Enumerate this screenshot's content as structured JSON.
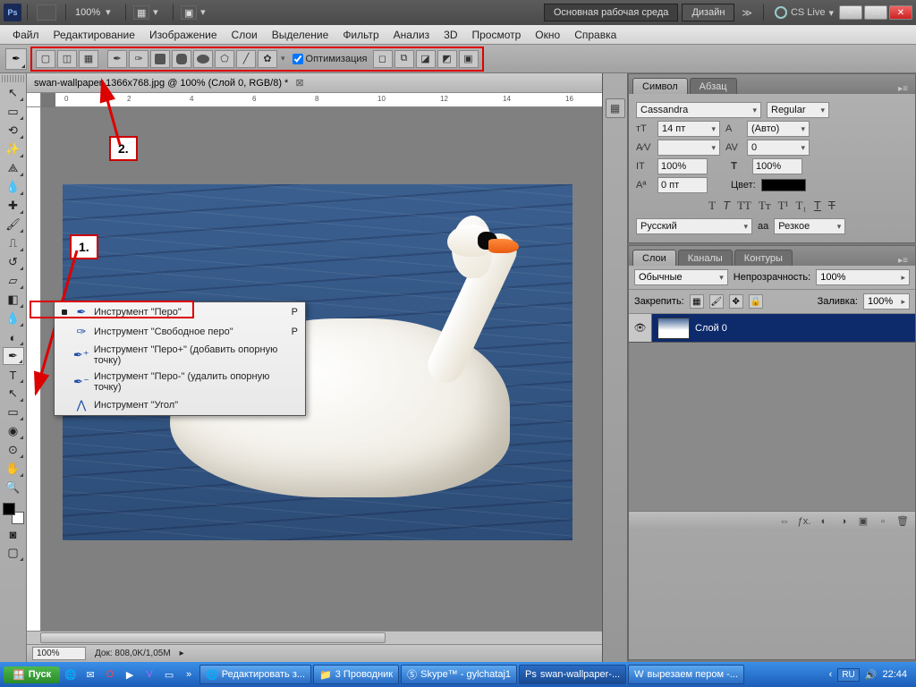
{
  "titlebar": {
    "zoom": "100%",
    "workspace_main": "Основная рабочая среда",
    "workspace_design": "Дизайн",
    "cslive": "CS Live"
  },
  "menu": {
    "file": "Файл",
    "edit": "Редактирование",
    "image": "Изображение",
    "layer": "Слои",
    "select": "Выделение",
    "filter": "Фильтр",
    "analysis": "Анализ",
    "threed": "3D",
    "view": "Просмотр",
    "window": "Окно",
    "help": "Справка"
  },
  "optbar": {
    "optimize": "Оптимизация"
  },
  "doc": {
    "tab": "swan-wallpaper-1366x768.jpg @ 100% (Слой 0, RGB/8) *",
    "status_zoom": "100%",
    "status_doc": "Док: 808,0K/1,05M"
  },
  "annotations": {
    "one": "1.",
    "two": "2."
  },
  "flyout": {
    "pen": "Инструмент \"Перо\"",
    "free": "Инструмент \"Свободное перо\"",
    "add": "Инструмент \"Перо+\" (добавить опорную точку)",
    "del": "Инструмент \"Перо-\" (удалить опорную точку)",
    "angle": "Инструмент \"Угол\"",
    "key_p": "P"
  },
  "char_panel": {
    "tab_symbol": "Символ",
    "tab_para": "Абзац",
    "font": "Cassandra",
    "style": "Regular",
    "size": "14 пт",
    "leading": "(Авто)",
    "tracking": "0",
    "vscale": "100%",
    "hscale": "100%",
    "baseline": "0 пт",
    "color_lbl": "Цвет:",
    "lang": "Русский",
    "aa_lbl": "aа",
    "aa": "Резкое"
  },
  "layers_panel": {
    "tab_layers": "Слои",
    "tab_channels": "Каналы",
    "tab_paths": "Контуры",
    "blend": "Обычные",
    "opacity_lbl": "Непрозрачность:",
    "opacity": "100%",
    "lock_lbl": "Закрепить:",
    "fill_lbl": "Заливка:",
    "fill": "100%",
    "layer0": "Слой 0"
  },
  "taskbar": {
    "start": "Пуск",
    "t1": "Редактировать з...",
    "t2": "3 Проводник",
    "t3": "Skype™ - gylchataj1",
    "t4": "swan-wallpaper-...",
    "t5": "вырезаем пером -...",
    "lang": "RU",
    "time": "22:44"
  }
}
